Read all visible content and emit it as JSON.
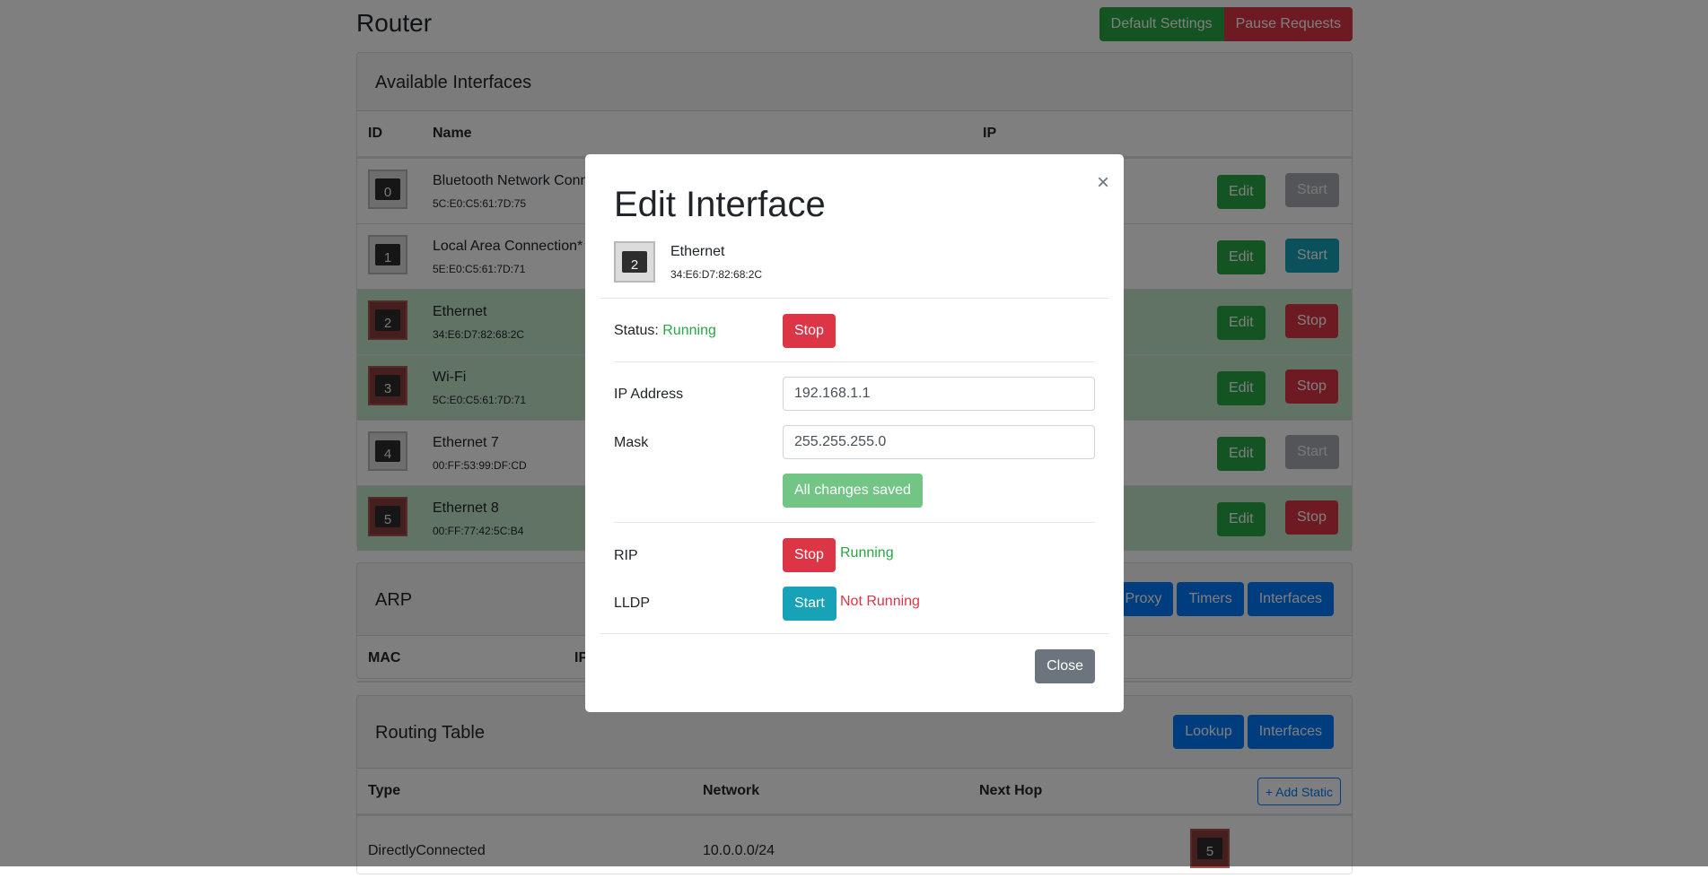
{
  "header": {
    "title": "Router",
    "default_settings": "Default Settings",
    "pause_requests": "Pause Requests"
  },
  "interfaces_card": {
    "title": "Available Interfaces",
    "columns": {
      "id": "ID",
      "name": "Name",
      "ip": "IP"
    },
    "rows": [
      {
        "id": "0",
        "name": "Bluetooth Network Conn",
        "mac": "5C:E0:C5:61:7D:75",
        "edit": "Edit",
        "action": "Start"
      },
      {
        "id": "1",
        "name": "Local Area Connection* ",
        "mac": "5E:E0:C5:61:7D:71",
        "edit": "Edit",
        "action": "Start"
      },
      {
        "id": "2",
        "name": "Ethernet",
        "mac": "34:E6:D7:82:68:2C",
        "edit": "Edit",
        "action": "Stop"
      },
      {
        "id": "3",
        "name": "Wi-Fi",
        "mac": "5C:E0:C5:61:7D:71",
        "edit": "Edit",
        "action": "Stop"
      },
      {
        "id": "4",
        "name": "Ethernet 7",
        "mac": "00:FF:53:99:DF:CD",
        "edit": "Edit",
        "action": "Start"
      },
      {
        "id": "5",
        "name": "Ethernet 8",
        "mac": "00:FF:77:42:5C:B4",
        "edit": "Edit",
        "action": "Stop"
      }
    ]
  },
  "arp_card": {
    "title": "ARP",
    "buttons": {
      "proxy": "Proxy",
      "timers": "Timers",
      "interfaces": "Interfaces"
    },
    "columns": {
      "mac": "MAC",
      "ip": "IP"
    }
  },
  "routing_card": {
    "title": "Routing Table",
    "buttons": {
      "lookup": "Lookup",
      "interfaces": "Interfaces",
      "add_static": "+ Add Static"
    },
    "columns": {
      "type": "Type",
      "network": "Network",
      "next_hop": "Next Hop"
    },
    "rows": [
      {
        "type": "DirectlyConnected",
        "network": "10.0.0.0/24",
        "next_hop_id": "5"
      }
    ]
  },
  "modal": {
    "title": "Edit Interface",
    "close_symbol": "×",
    "interface": {
      "id": "2",
      "name": "Ethernet",
      "mac": "34:E6:D7:82:68:2C"
    },
    "status_label": "Status:",
    "status_value": "Running",
    "status_button": "Stop",
    "ip_label": "IP Address",
    "ip_value": "192.168.1.1",
    "mask_label": "Mask",
    "mask_value": "255.255.255.0",
    "saved_button": "All changes saved",
    "rip": {
      "label": "RIP",
      "button": "Stop",
      "state": "Running"
    },
    "lldp": {
      "label": "LLDP",
      "button": "Start",
      "state": "Not Running"
    },
    "close_button": "Close"
  },
  "colors": {
    "success": "#28a745",
    "danger": "#dc3545",
    "info": "#17a2b8",
    "primary": "#007bff",
    "secondary": "#6c757d",
    "row_active": "#c3e6cb"
  }
}
